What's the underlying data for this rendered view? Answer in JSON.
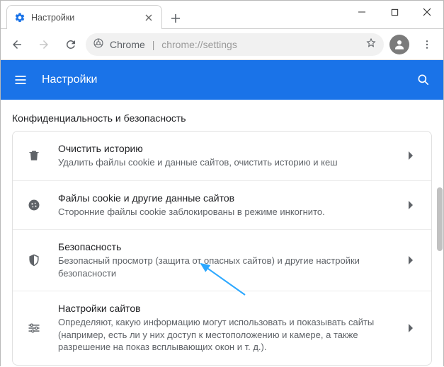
{
  "tab": {
    "title": "Настройки"
  },
  "omnibox": {
    "prefix": "Chrome",
    "path": "chrome://settings"
  },
  "header": {
    "title": "Настройки"
  },
  "section": {
    "title": "Конфиденциальность и безопасность"
  },
  "rows": [
    {
      "title": "Очистить историю",
      "subtitle": "Удалить файлы cookie и данные сайтов, очистить историю и кеш"
    },
    {
      "title": "Файлы cookie и другие данные сайтов",
      "subtitle": "Сторонние файлы cookie заблокированы в режиме инкогнито."
    },
    {
      "title": "Безопасность",
      "subtitle": "Безопасный просмотр (защита от опасных сайтов) и другие настройки безопасности"
    },
    {
      "title": "Настройки сайтов",
      "subtitle": "Определяют, какую информацию могут использовать и показывать сайты (например, есть ли у них доступ к местоположению и камере, а также разрешение на показ всплывающих окон и т. д.)."
    }
  ]
}
